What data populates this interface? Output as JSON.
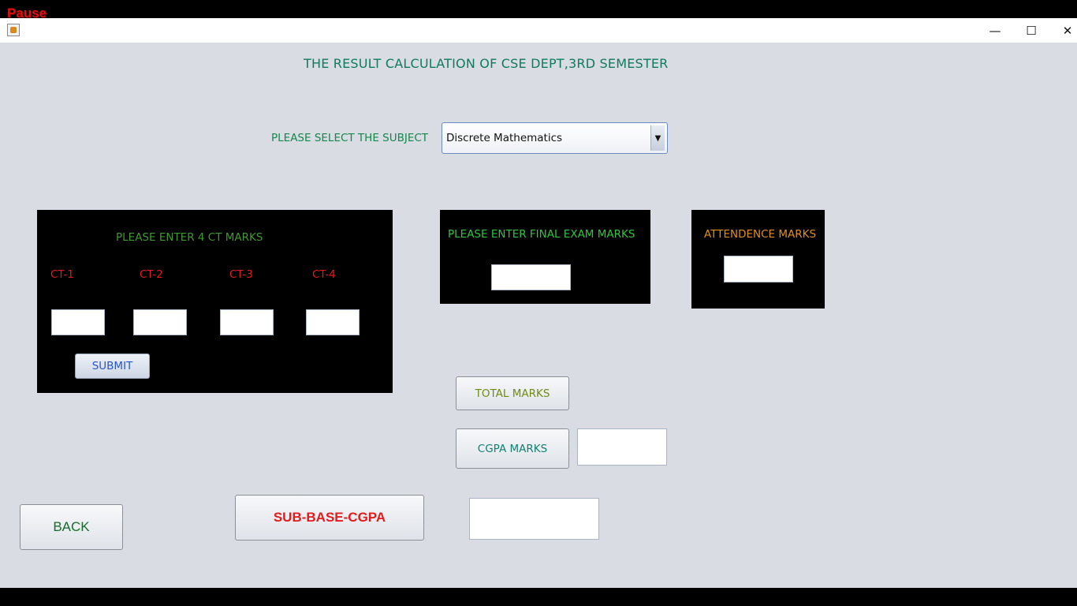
{
  "overlay": {
    "pause_label": "Pause"
  },
  "window": {
    "controls": {
      "minimize": "—",
      "maximize": "☐",
      "close": "✕"
    }
  },
  "header": {
    "title": "THE RESULT CALCULATION OF CSE DEPT,3RD SEMESTER"
  },
  "subject": {
    "label": "PLEASE SELECT THE SUBJECT",
    "selected": "Discrete Mathematics",
    "arrow": "▼"
  },
  "ct_panel": {
    "heading": "PLEASE ENTER 4 CT MARKS",
    "labels": [
      "CT-1",
      "CT-2",
      "CT-3",
      "CT-4"
    ],
    "values": [
      "",
      "",
      "",
      ""
    ],
    "submit_label": "SUBMIT"
  },
  "final_panel": {
    "heading": "PLEASE ENTER FINAL EXAM MARKS",
    "value": ""
  },
  "attendance_panel": {
    "heading": "ATTENDENCE MARKS",
    "value": ""
  },
  "actions": {
    "total_label": "TOTAL MARKS",
    "cgpa_label": "CGPA MARKS",
    "cgpa_value": "",
    "back_label": "BACK",
    "subbase_label": "SUB-BASE-CGPA",
    "subbase_value": ""
  },
  "colors": {
    "window_bg": "#d9dce3",
    "panel_bg": "#000000",
    "title_color": "#0f7a5e",
    "ct_label_color": "#e31b1b",
    "heading_green": "#1db33a",
    "attendance_color": "#e2901a"
  }
}
